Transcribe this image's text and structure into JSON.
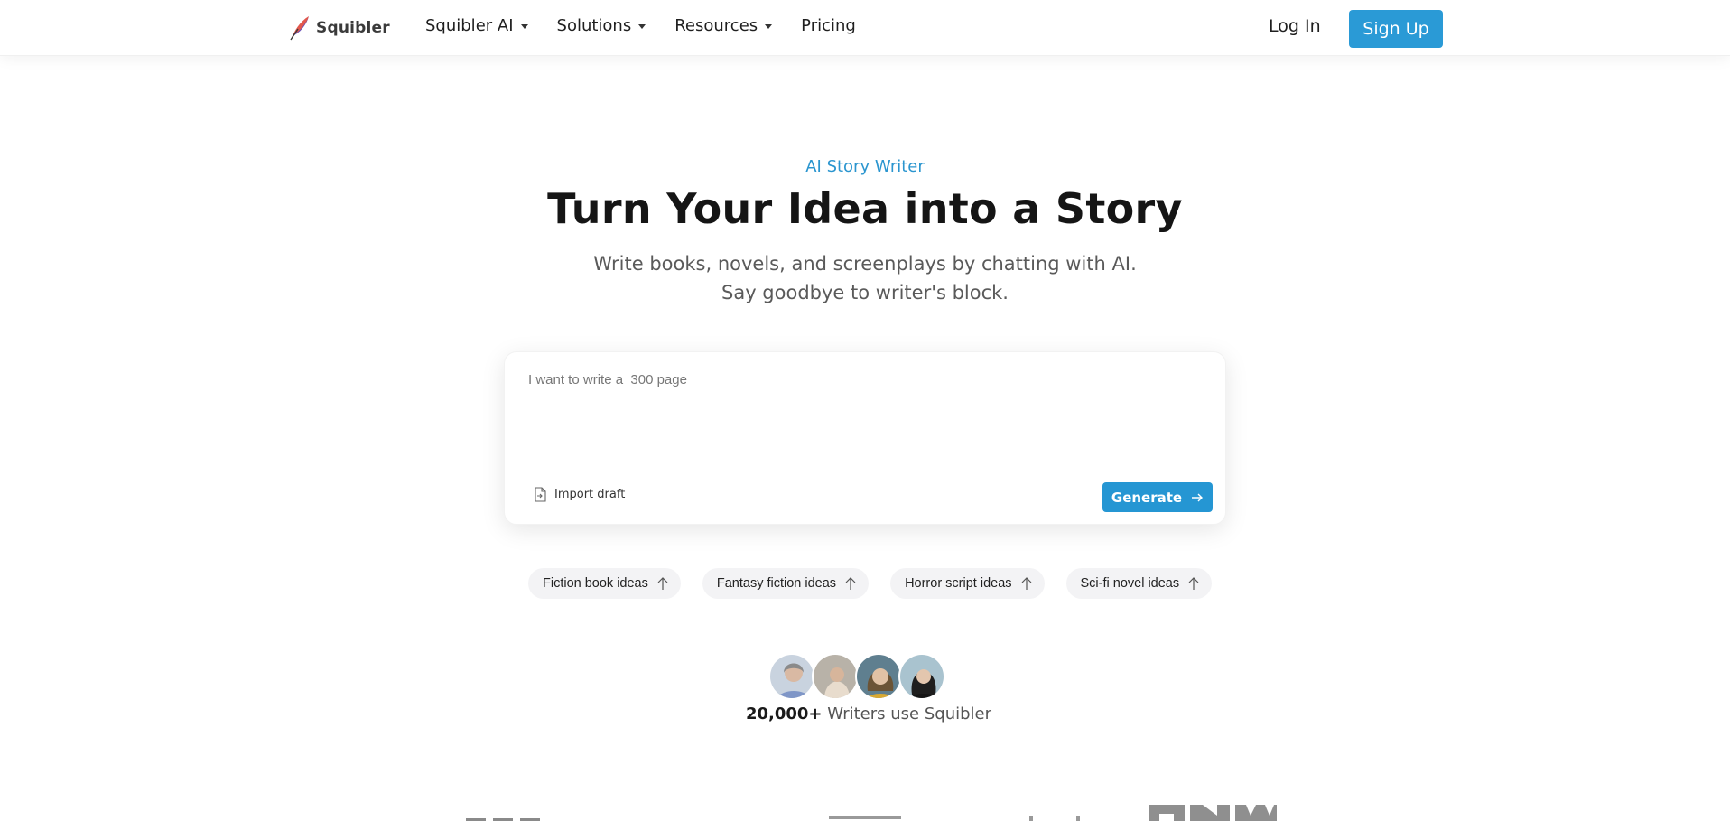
{
  "header": {
    "logo_text": "Squibler",
    "nav": [
      {
        "label": "Squibler AI",
        "dropdown": true
      },
      {
        "label": "Solutions",
        "dropdown": true
      },
      {
        "label": "Resources",
        "dropdown": true
      },
      {
        "label": "Pricing",
        "dropdown": false
      }
    ],
    "login_label": "Log In",
    "signup_label": "Sign Up"
  },
  "hero": {
    "eyebrow": "AI Story Writer",
    "title": "Turn Your Idea into a Story",
    "subtitle": "Write books, novels, and screenplays by chatting with AI. Say goodbye to writer's block."
  },
  "prompt": {
    "value": "I want to write a  300 page",
    "import_label": "Import draft",
    "generate_label": "Generate"
  },
  "suggestions": [
    "Fiction book ideas",
    "Fantasy fiction ideas",
    "Horror script ideas",
    "Sci-fi novel ideas"
  ],
  "social_proof": {
    "count": "20,000+",
    "text": " Writers use Squibler"
  },
  "colors": {
    "accent": "#2a9ad6",
    "title": "#151515",
    "muted": "#5a5a5a"
  }
}
